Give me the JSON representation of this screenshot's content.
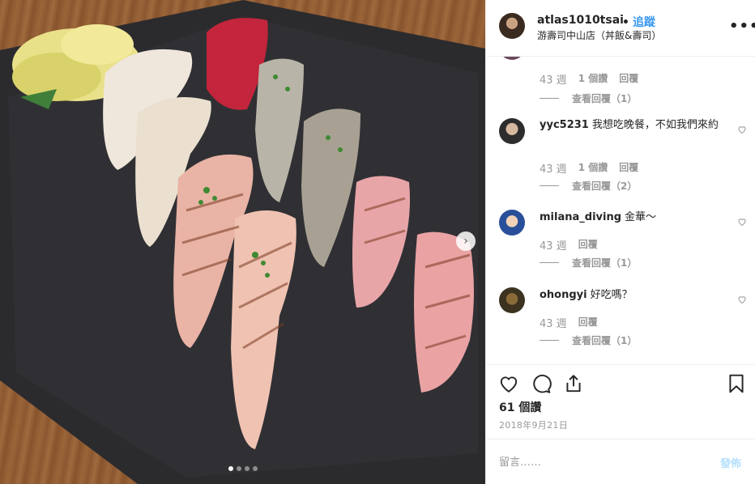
{
  "post": {
    "username": "atlas1010tsai",
    "separator": "•",
    "follow_label": "追蹤",
    "location": "游壽司中山店（丼飯&壽司）",
    "more_icon": "more-options-icon",
    "likes": "61 個讚",
    "date": "2018年9月21日"
  },
  "comments": [
    {
      "username": "",
      "text": "",
      "time": "43 週",
      "likes": "1 個讚",
      "reply": "回覆",
      "view_replies": "查看回覆（1）"
    },
    {
      "username": "yyc5231",
      "text": "我想吃晚餐，不如我們來約",
      "time": "43 週",
      "likes": "1 個讚",
      "reply": "回覆",
      "view_replies": "查看回覆（2）"
    },
    {
      "username": "milana_diving",
      "text": "金華～",
      "time": "43 週",
      "reply": "回覆",
      "view_replies": "查看回覆（1）"
    },
    {
      "username": "ohongyi",
      "text": "好吃嗎？",
      "time": "43 週",
      "reply": "回覆",
      "view_replies": "查看回覆（1）"
    }
  ],
  "carousel": {
    "next_icon": "chevron-right-icon",
    "next_glyph": "›",
    "dots": 4,
    "active_index": 0
  },
  "compose": {
    "placeholder": "留言……",
    "post_label": "發佈"
  },
  "colors": {
    "accent": "#3897f0",
    "post_disabled": "#b2dffc",
    "muted": "#999999"
  }
}
